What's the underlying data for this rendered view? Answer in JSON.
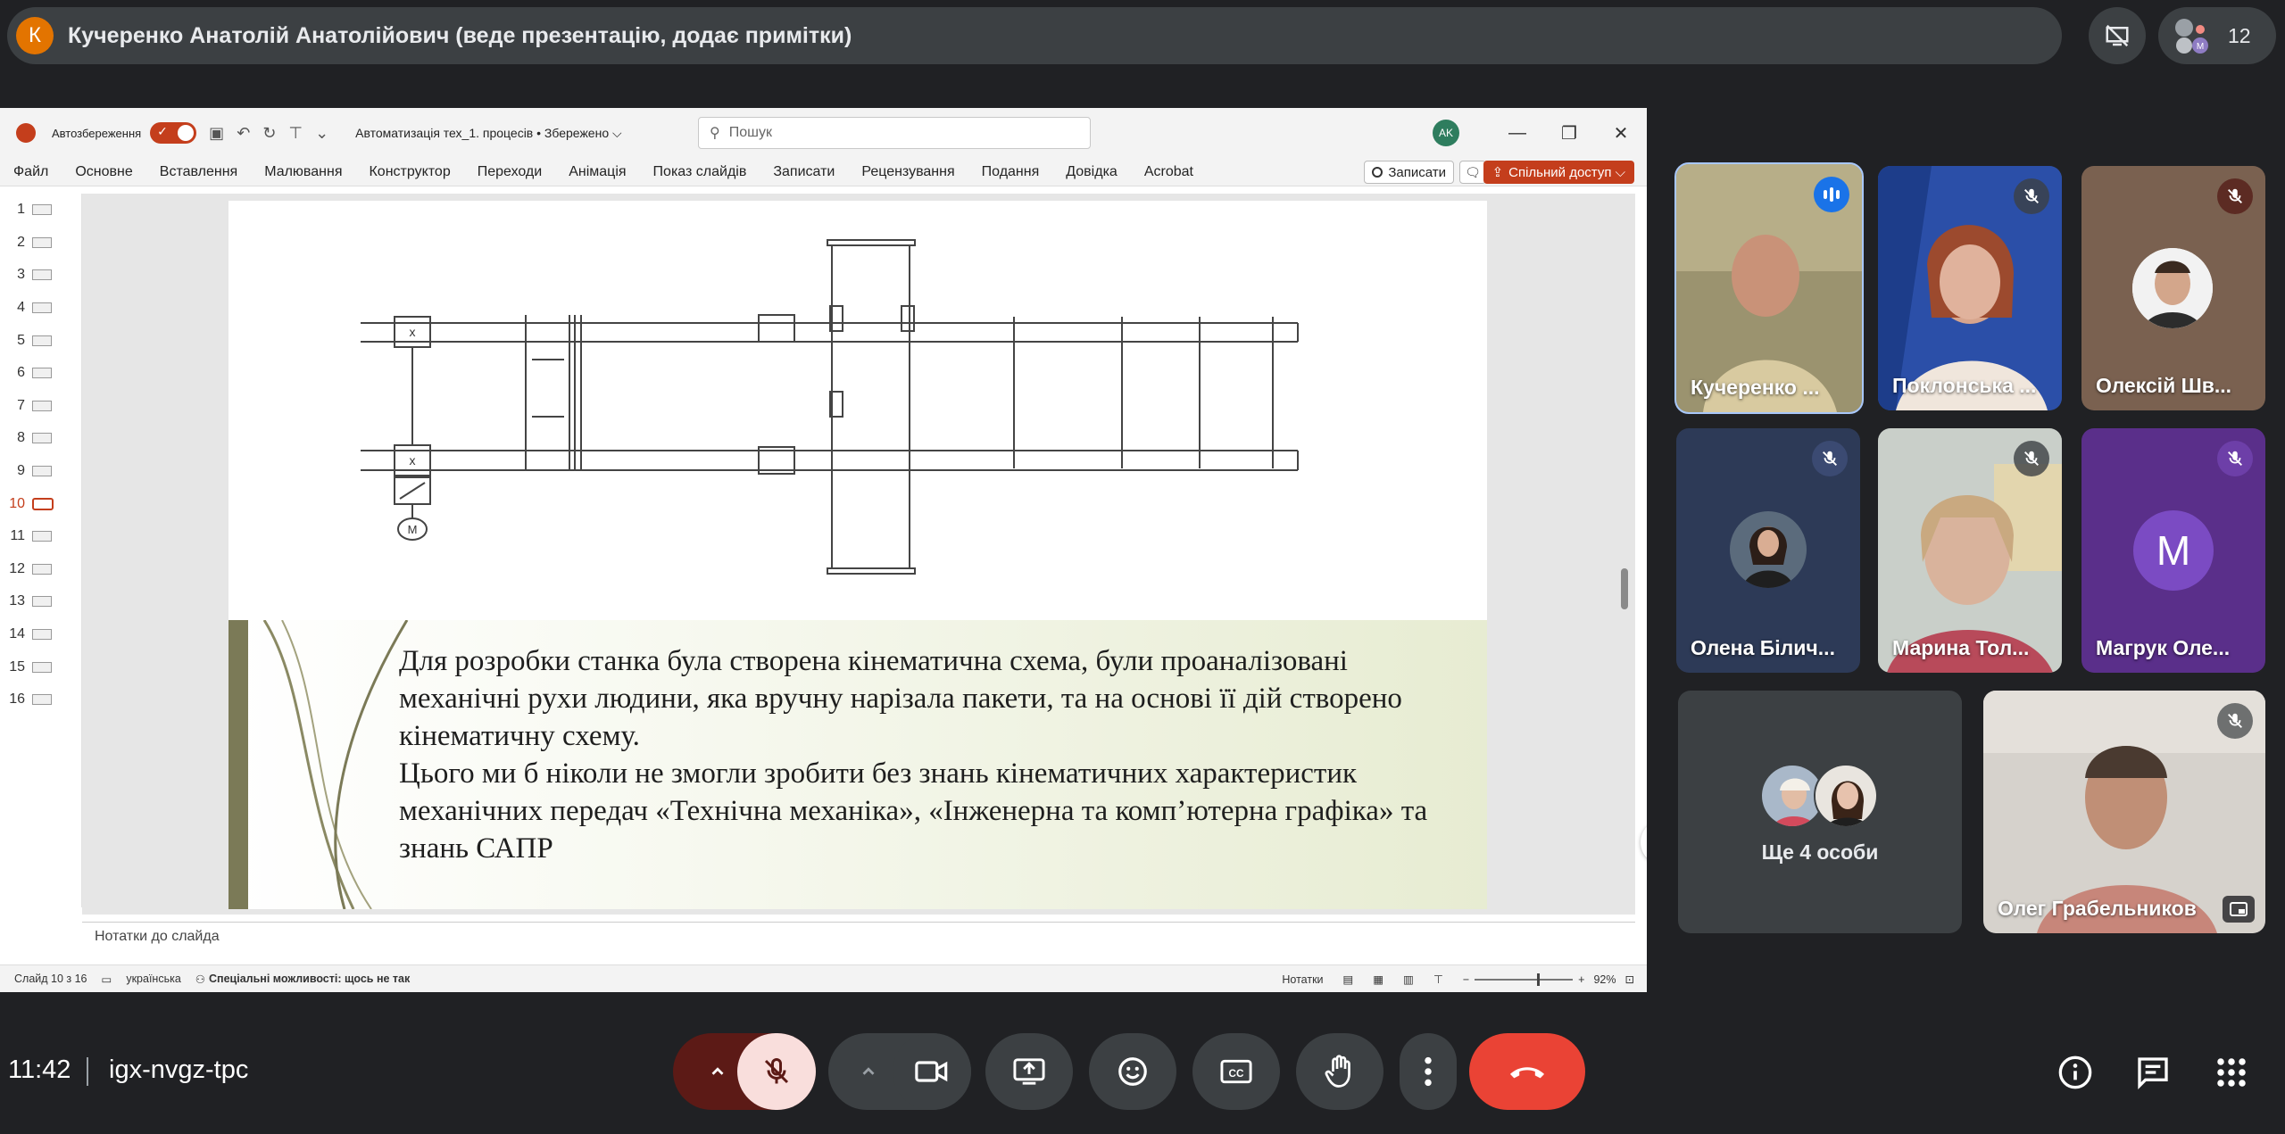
{
  "presenter": {
    "avatar_letter": "К",
    "text": "Кучеренко Анатолій Анатолійович (веде презентацію, додає примітки)"
  },
  "participants_count": "12",
  "ppt": {
    "autosave_label": "Автозбереження",
    "doc_name": "Автоматизація тех_1. процесів • Збережено ⌵",
    "search_placeholder": "Пошук",
    "user_initials": "AK",
    "menu": [
      "Файл",
      "Основне",
      "Вставлення",
      "Малювання",
      "Конструктор",
      "Переходи",
      "Анімація",
      "Показ слайдів",
      "Записати",
      "Рецензування",
      "Подання",
      "Довідка",
      "Acrobat"
    ],
    "record_label": "Записати",
    "share_label": "Спільний доступ ⌵",
    "slide_numbers": [
      "1",
      "2",
      "3",
      "4",
      "5",
      "6",
      "7",
      "8",
      "9",
      "10",
      "11",
      "12",
      "13",
      "14",
      "15",
      "16"
    ],
    "active_slide": "10",
    "slide_paragraphs": [
      "Для розробки станка була створена кінематична схема, були проаналізовані механічні рухи людини, яка вручну нарізала пакети, та на основі її дій створено кінематичну схему.",
      "Цього ми б ніколи не змогли зробити без знань кінематичних характеристик механічних передач  «Технічна механіка», «Інженерна та комп’ютерна графіка» та знань САПР"
    ],
    "diagram_labels": {
      "x1": "x",
      "x2": "x",
      "motor": "M"
    },
    "notes_label": "Нотатки до слайда",
    "status": {
      "slide": "Слайд 10 з 16",
      "language": "українська",
      "accessibility": "Спеціальні можливості: щось не так",
      "notes": "Нотатки",
      "zoom": "92%"
    }
  },
  "tiles": [
    {
      "name": "Кучеренко ...",
      "state": "speaking"
    },
    {
      "name": "Поклонська ...",
      "state": "muted"
    },
    {
      "name": "Олексій Шв...",
      "state": "muted"
    },
    {
      "name": "Олена Білич...",
      "state": "muted"
    },
    {
      "name": "Марина Тол...",
      "state": "muted"
    },
    {
      "name": "Магрук Оле...",
      "state": "muted",
      "letter": "M"
    },
    {
      "name": "Ще 4 особи",
      "state": "group"
    },
    {
      "name": "Олег Грабельников",
      "state": "muted"
    }
  ],
  "bottom": {
    "time": "11:42",
    "code": "igx-nvgz-tpc"
  },
  "colors": {
    "meet_bg": "#202124",
    "control_bg": "#3c4043",
    "end_call": "#ea4335",
    "ppt_accent": "#c43e1c"
  }
}
